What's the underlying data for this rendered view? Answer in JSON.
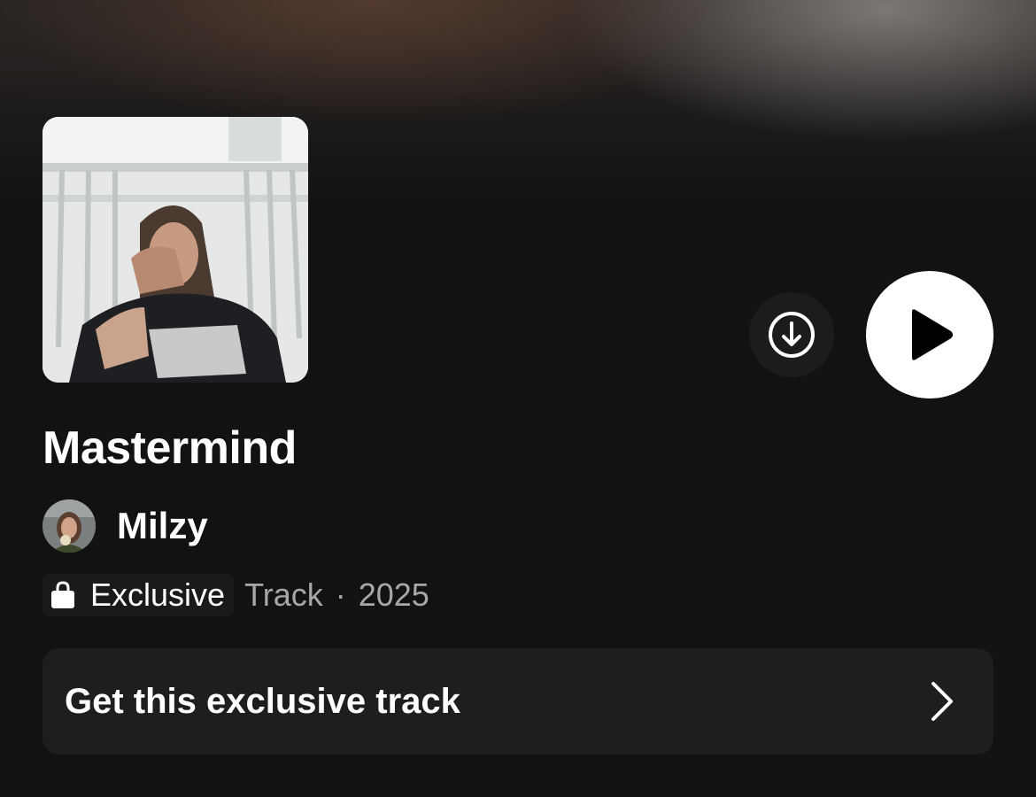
{
  "track": {
    "title": "Mastermind",
    "artist": "Milzy",
    "badge_label": "Exclusive",
    "type": "Track",
    "separator": "·",
    "year": "2025"
  },
  "cta": {
    "label": "Get this exclusive track"
  },
  "icons": {
    "download": "download-circle-icon",
    "play": "play-icon",
    "badge": "shopping-bag-icon",
    "chevron": "chevron-right-icon"
  },
  "colors": {
    "background": "#121212",
    "card": "#1e1e1e",
    "play_button": "#ffffff",
    "secondary_text": "#a7a7a7"
  }
}
